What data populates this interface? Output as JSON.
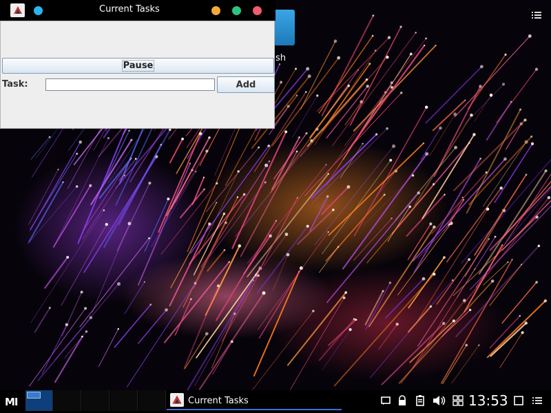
{
  "window": {
    "title": "Current Tasks",
    "pause_label": "Pause",
    "task_label": "Task:",
    "task_value": "",
    "add_label": "Add"
  },
  "desktop": {
    "icon_label_fragment": "sh"
  },
  "taskbar": {
    "logo": "MI",
    "active_task_label": "Current Tasks",
    "clock": "13:53",
    "tray_icons": [
      "chat-icon",
      "lock-icon",
      "clipboard-icon",
      "volume-icon",
      "grid-icon",
      "tiles-icon",
      "show-desktop-icon",
      "menu-icon"
    ]
  },
  "colors": {
    "titlebar_dot_blue": "#29b6ef",
    "titlebar_dot_orange": "#f5a93a",
    "titlebar_dot_green": "#2ec27e",
    "titlebar_dot_red": "#f05d6c",
    "taskbar_accent": "#3b6fd6"
  }
}
